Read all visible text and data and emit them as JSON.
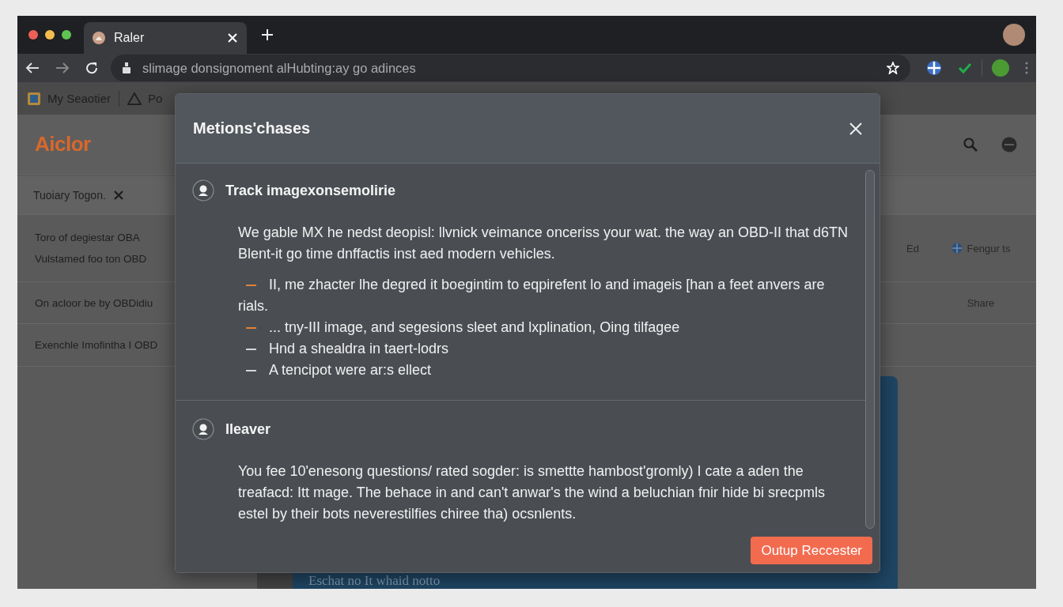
{
  "browser": {
    "tab": {
      "title": "Raler"
    },
    "address": "slimage donsignoment alHubting:ay go adinces",
    "bookmarks": [
      {
        "label": "My Seaotier"
      },
      {
        "label": "Po"
      }
    ]
  },
  "page": {
    "logo": "Aiclor",
    "filter": {
      "label": "Tuoiary Togon."
    },
    "rows": [
      {
        "lines": [
          "Toro of degiestar OBA",
          "Vulstamed foo ton OBD"
        ],
        "column_2": "Ed",
        "column_3": "Fengur ts"
      },
      {
        "lines": [
          "On acloor be by OBDidiu"
        ],
        "column_3": "Share"
      },
      {
        "lines": [
          "Exenchle Imofintha I OBD"
        ]
      }
    ],
    "card_text": "Eschat no It whaid notto"
  },
  "dialog": {
    "title": "Metions'chases",
    "sections": [
      {
        "title": "Track imagexonsemolirie",
        "paragraph": "We gable MX he nedst deopisl: llvnick veimance onceriss your wat. the way an OBD-II that d6TN Blent-it go time dnffactis inst aed modern vehicles.",
        "bullets": [
          {
            "text": "II, me zhacter lhe degred it boegintim to eqpirefent lo and imageis [han a feet anvers are rials.",
            "color": "#e0823a"
          },
          {
            "text": "... tny-III image, and segesions sleet and lxplination, Oing tilfagee",
            "color": "#e0823a"
          },
          {
            "text": "Hnd a shealdra in taert-lodrs",
            "color": "#d4d6d8"
          },
          {
            "text": "A tencipot were ar:s ellect",
            "color": "#d4d6d8"
          }
        ]
      },
      {
        "title": "Ileaver",
        "paragraph": "You fee 10'enesong questions/ rated sogder: is smettte hambost'gromly) I cate a aden the treafacd: Itt mage. The behace in and can't anwar's the wind a beluchian fnir hide bi srecpmls estel by their bots neverestilfies chiree tha) ocsnlents."
      }
    ],
    "primary_button": "Outup Reccester"
  }
}
